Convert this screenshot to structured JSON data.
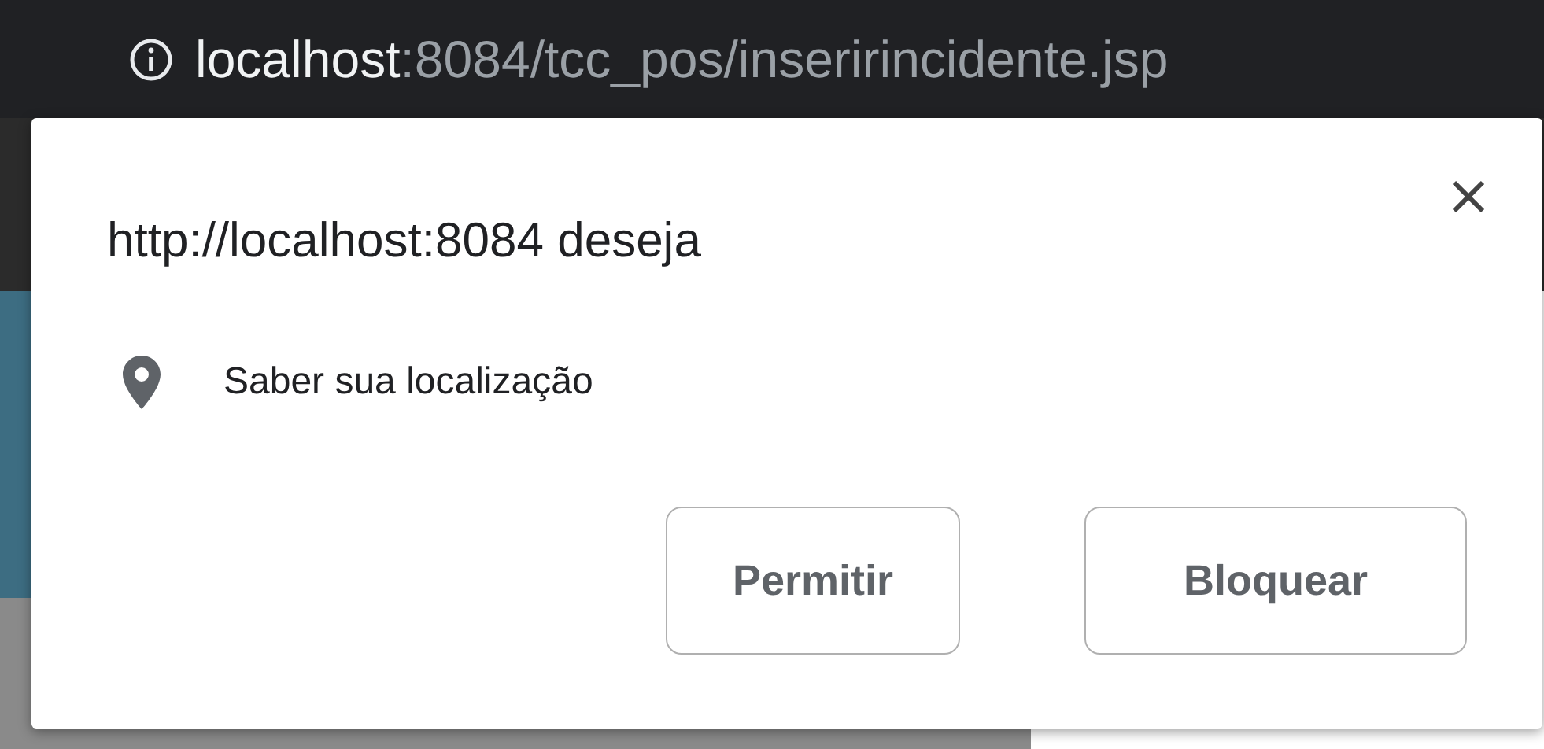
{
  "address_bar": {
    "host": "localhost",
    "path": ":8084/tcc_pos/inseririncidente.jsp"
  },
  "dialog": {
    "title": "http://localhost:8084 deseja",
    "permission": "Saber sua localização",
    "buttons": [
      {
        "label": "Permitir"
      },
      {
        "label": "Bloquear"
      }
    ]
  }
}
